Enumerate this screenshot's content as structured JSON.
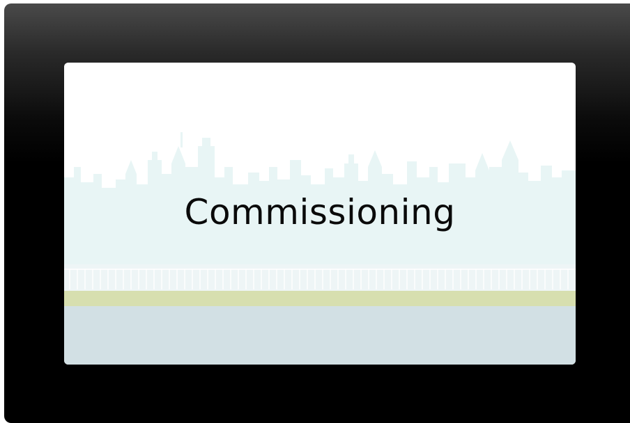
{
  "screen": {
    "title": "Commissioning"
  },
  "colors": {
    "bezel_top": "#4a4a4a",
    "bezel": "#000000",
    "screen_bg": "#ffffff",
    "skyline": "#e8f5f5",
    "railing": "#eef5f6",
    "stripe_green": "#d7dfaf",
    "ground": "#d2e0e4",
    "title_text": "#0a0a0a"
  },
  "icons": [
    "city-skyline-graphic"
  ]
}
